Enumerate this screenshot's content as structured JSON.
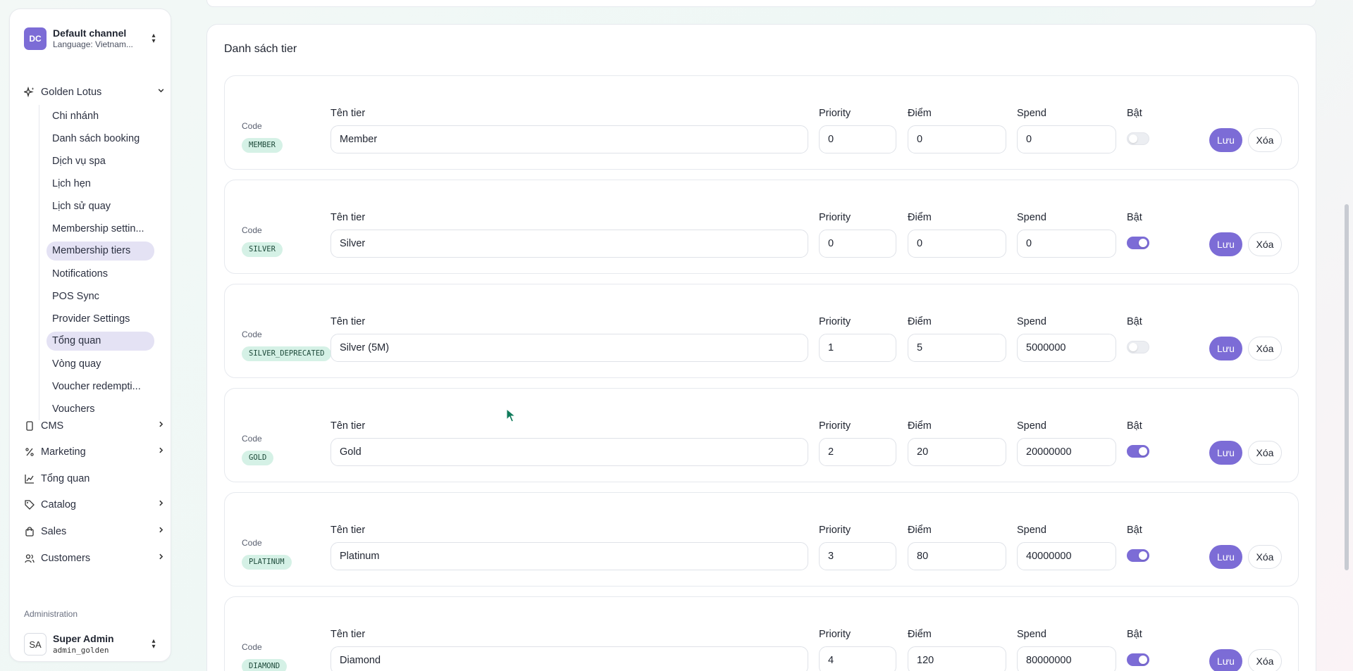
{
  "sidebar": {
    "channel": {
      "initials": "DC",
      "name": "Default channel",
      "language": "Language: Vietnam..."
    },
    "group": {
      "label": "Golden Lotus"
    },
    "sub_items": [
      {
        "label": "Chi nhánh",
        "active": false
      },
      {
        "label": "Danh sách booking",
        "active": false
      },
      {
        "label": "Dịch vụ spa",
        "active": false
      },
      {
        "label": "Lịch hẹn",
        "active": false
      },
      {
        "label": "Lịch sử quay",
        "active": false
      },
      {
        "label": "Membership settin...",
        "active": false
      },
      {
        "label": "Membership tiers",
        "active": true
      },
      {
        "label": "Notifications",
        "active": false
      },
      {
        "label": "POS Sync",
        "active": false
      },
      {
        "label": "Provider Settings",
        "active": false
      },
      {
        "label": "Tổng quan",
        "active": true
      },
      {
        "label": "Vòng quay",
        "active": false
      },
      {
        "label": "Voucher redempti...",
        "active": false
      },
      {
        "label": "Vouchers",
        "active": false
      }
    ],
    "top_items": [
      {
        "label": "CMS",
        "icon": "phone-icon",
        "expandable": true
      },
      {
        "label": "Marketing",
        "icon": "percent-icon",
        "expandable": true
      },
      {
        "label": "Tổng quan",
        "icon": "chart-line-icon",
        "expandable": false
      },
      {
        "label": "Catalog",
        "icon": "tag-icon",
        "expandable": true
      },
      {
        "label": "Sales",
        "icon": "shopping-bag-icon",
        "expandable": true
      },
      {
        "label": "Customers",
        "icon": "users-icon",
        "expandable": true
      }
    ],
    "admin_label": "Administration",
    "user": {
      "initials": "SA",
      "name": "Super Admin",
      "login": "admin_golden"
    }
  },
  "main": {
    "section_title": "Danh sách tier",
    "labels": {
      "code": "Code",
      "name": "Tên tier",
      "priority": "Priority",
      "points": "Điểm",
      "spend": "Spend",
      "enabled": "Bật",
      "save": "Lưu",
      "delete": "Xóa"
    },
    "tiers": [
      {
        "code": "MEMBER",
        "name": "Member",
        "priority": "0",
        "points": "0",
        "spend": "0",
        "enabled": false
      },
      {
        "code": "SILVER",
        "name": "Silver",
        "priority": "0",
        "points": "0",
        "spend": "0",
        "enabled": true
      },
      {
        "code": "SILVER_DEPRECATED",
        "name": "Silver (5M)",
        "priority": "1",
        "points": "5",
        "spend": "5000000",
        "enabled": false
      },
      {
        "code": "GOLD",
        "name": "Gold",
        "priority": "2",
        "points": "20",
        "spend": "20000000",
        "enabled": true
      },
      {
        "code": "PLATINUM",
        "name": "Platinum",
        "priority": "3",
        "points": "80",
        "spend": "40000000",
        "enabled": true
      },
      {
        "code": "DIAMOND",
        "name": "Diamond",
        "priority": "4",
        "points": "120",
        "spend": "80000000",
        "enabled": true
      }
    ]
  },
  "colors": {
    "accent": "#7c6cd6",
    "badge_bg": "#d5f1e6",
    "active_nav": "#e4e2f4"
  }
}
